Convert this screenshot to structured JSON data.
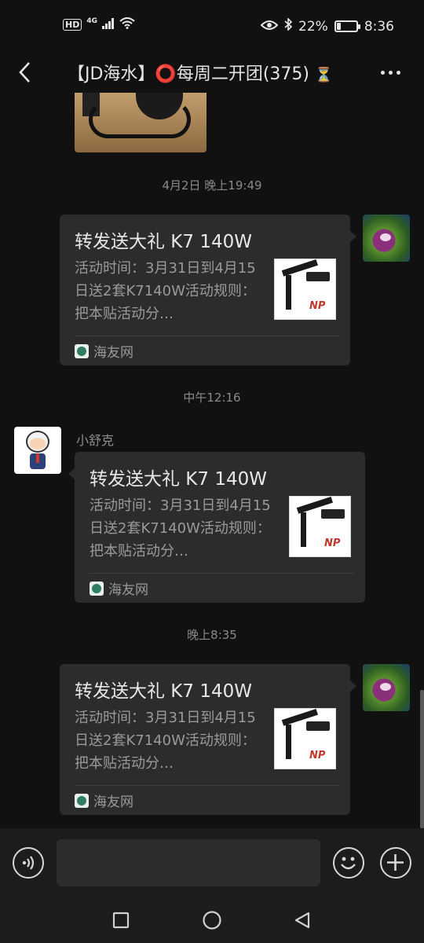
{
  "status_bar": {
    "network": "HD",
    "signal": "4G",
    "battery_percent": "22%",
    "battery_level": 0.22,
    "time": "8:36"
  },
  "header": {
    "title": "【JD海水】⭕️每周二开团(375)",
    "title_suffix": "⏳"
  },
  "messages": [
    {
      "time": "4月2日 晚上19:49",
      "side": "right",
      "avatar": "reef-coral-avatar",
      "card": {
        "title": "转发送大礼 K7 140W",
        "desc": "活动时间：3月31日到4月15日送2套K7140W活动规则：把本贴活动分…",
        "source": "海友网",
        "thumb_logo": "NP"
      }
    },
    {
      "time": "中午12:16",
      "side": "left",
      "sender": "小舒克",
      "avatar": "cartoon-boy-avatar",
      "card": {
        "title": "转发送大礼 K7 140W",
        "desc": "活动时间：3月31日到4月15日送2套K7140W活动规则：把本贴活动分…",
        "source": "海友网",
        "thumb_logo": "NP"
      }
    },
    {
      "time": "晚上8:35",
      "side": "right",
      "avatar": "reef-coral-avatar",
      "card": {
        "title": "转发送大礼 K7 140W",
        "desc": "活动时间：3月31日到4月15日送2套K7140W活动规则：把本贴活动分…",
        "source": "海友网",
        "thumb_logo": "NP"
      }
    }
  ],
  "input": {
    "value": "",
    "placeholder": ""
  },
  "icons": {
    "back": "back-arrow-icon",
    "more": "more-dots-icon",
    "voice": "voice-icon",
    "emoji": "emoji-icon",
    "plus": "plus-icon",
    "nav_recent": "square-icon",
    "nav_home": "circle-icon",
    "nav_back": "triangle-back-icon"
  },
  "colors": {
    "background": "#111111",
    "bubble": "#2c2c2c",
    "bar": "#1c1c1c"
  }
}
